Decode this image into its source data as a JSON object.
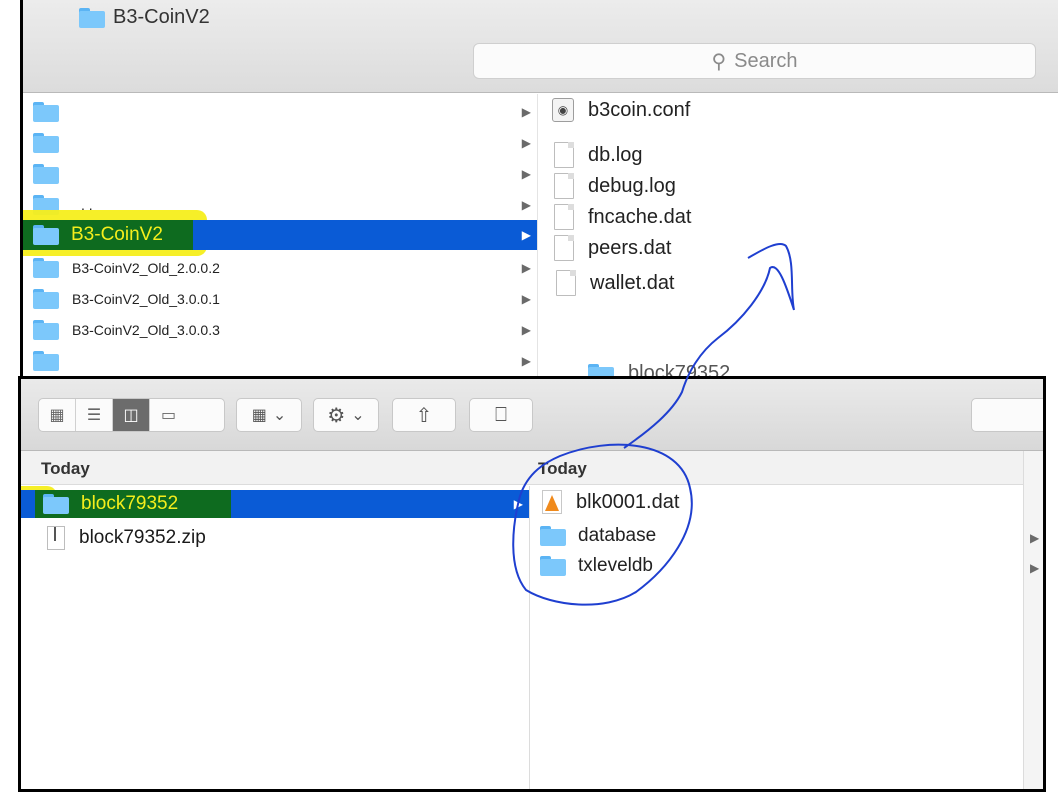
{
  "top_window": {
    "title": "B3-CoinV2",
    "search_placeholder": "Search",
    "sidebar_items": [
      {
        "label": ""
      },
      {
        "label": ""
      },
      {
        "label": ""
      },
      {
        "label": ". ."
      },
      {
        "label": "B3-CoinV2",
        "selected": true
      },
      {
        "label": "B3-CoinV2_Old_2.0.0.2"
      },
      {
        "label": "B3-CoinV2_Old_3.0.0.1"
      },
      {
        "label": "B3-CoinV2_Old_3.0.0.3"
      },
      {
        "label": ""
      }
    ],
    "files": [
      {
        "name": "b3coin.conf"
      },
      {
        "name": "db.log"
      },
      {
        "name": "debug.log"
      },
      {
        "name": "fncache.dat"
      },
      {
        "name": "peers.dat"
      },
      {
        "name": "wallet.dat"
      }
    ],
    "peek_label": "block79352"
  },
  "bottom_window": {
    "header_left": "Today",
    "header_right": "Today",
    "left_items": [
      {
        "label": "block79352",
        "selected": true
      },
      {
        "label": "block79352.zip"
      }
    ],
    "right_items": [
      {
        "label": "blk0001.dat"
      },
      {
        "label": "database"
      },
      {
        "label": "txleveldb"
      }
    ]
  },
  "colors": {
    "selection": "#0a5bd6",
    "highlighter_yellow": "#f5ee1c",
    "annotation_blue": "#1f3fd0",
    "folder_blue": "#7cc8fb"
  }
}
